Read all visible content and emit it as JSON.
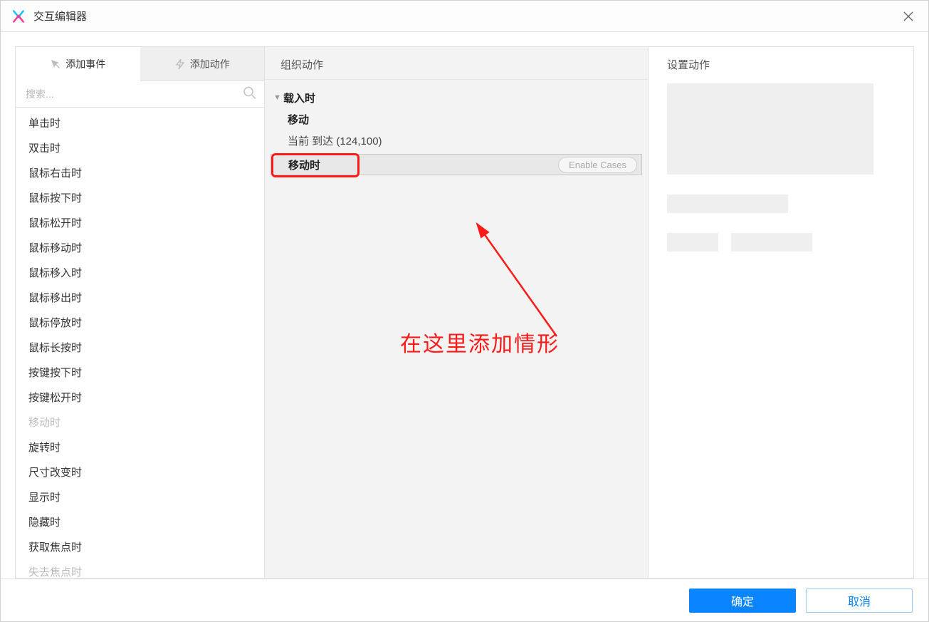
{
  "window": {
    "title": "交互编辑器"
  },
  "left": {
    "tabs": {
      "add_event": "添加事件",
      "add_action": "添加动作"
    },
    "search_placeholder": "搜索...",
    "events": [
      {
        "label": "单击时",
        "state": "normal"
      },
      {
        "label": "双击时",
        "state": "normal"
      },
      {
        "label": "鼠标右击时",
        "state": "normal"
      },
      {
        "label": "鼠标按下时",
        "state": "normal"
      },
      {
        "label": "鼠标松开时",
        "state": "normal"
      },
      {
        "label": "鼠标移动时",
        "state": "normal"
      },
      {
        "label": "鼠标移入时",
        "state": "normal"
      },
      {
        "label": "鼠标移出时",
        "state": "normal"
      },
      {
        "label": "鼠标停放时",
        "state": "normal"
      },
      {
        "label": "鼠标长按时",
        "state": "normal"
      },
      {
        "label": "按键按下时",
        "state": "normal"
      },
      {
        "label": "按键松开时",
        "state": "normal"
      },
      {
        "label": "移动时",
        "state": "disabled"
      },
      {
        "label": "旋转时",
        "state": "normal"
      },
      {
        "label": "尺寸改变时",
        "state": "normal"
      },
      {
        "label": "显示时",
        "state": "normal"
      },
      {
        "label": "隐藏时",
        "state": "normal"
      },
      {
        "label": "获取焦点时",
        "state": "normal"
      },
      {
        "label": "失去焦点时",
        "state": "cut"
      }
    ]
  },
  "middle": {
    "header": "组织动作",
    "tree": {
      "root_label": "载入时",
      "action_label": "移动",
      "action_detail": "当前 到达 (124,100)",
      "selected_label": "移动时",
      "enable_cases_label": "Enable Cases"
    },
    "annotation_text": "在这里添加情形"
  },
  "right": {
    "header": "设置动作"
  },
  "footer": {
    "ok": "确定",
    "cancel": "取消"
  }
}
